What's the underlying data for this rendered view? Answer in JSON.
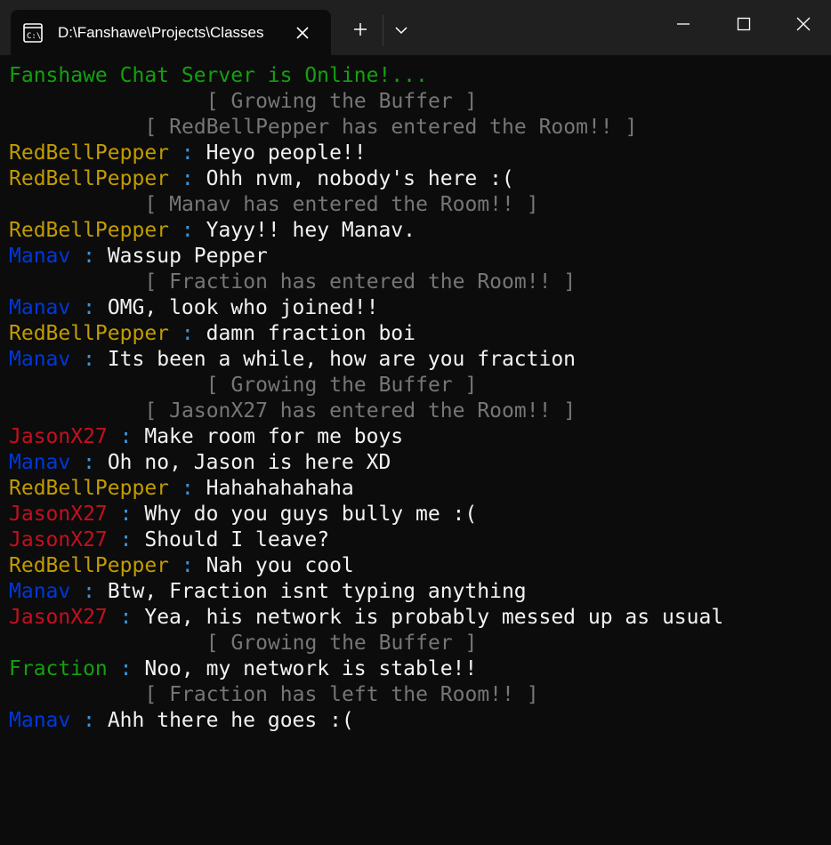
{
  "window": {
    "tab_title": "D:\\Fanshawe\\Projects\\Classes",
    "tab_icon": "terminal-icon",
    "buttons": {
      "new_tab": "plus-icon",
      "dropdown": "chevron-down-icon",
      "minimize": "minimize-icon",
      "maximize": "maximize-icon",
      "close": "close-icon"
    }
  },
  "colors": {
    "background": "#0c0c0c",
    "titlebar": "#202020",
    "online_text": "#13a10e",
    "system_text": "#767676",
    "message_text": "#f2f2f2",
    "separator": "#3a96dd",
    "RedBellPepper": "#c19c00",
    "Manav": "#0037da",
    "JasonX27": "#c50f1f",
    "Fraction": "#13a10e"
  },
  "terminal": {
    "separator": ":",
    "online_message": "Fanshawe Chat Server is Online!...",
    "lines": [
      {
        "type": "system",
        "text": "[ Growing the Buffer ]"
      },
      {
        "type": "system",
        "text": "[ RedBellPepper has entered the Room!! ]"
      },
      {
        "type": "chat",
        "user": "RedBellPepper",
        "text": "Heyo people!!"
      },
      {
        "type": "chat",
        "user": "RedBellPepper",
        "text": "Ohh nvm, nobody's here :("
      },
      {
        "type": "system",
        "text": "[ Manav has entered the Room!! ]"
      },
      {
        "type": "chat",
        "user": "RedBellPepper",
        "text": "Yayy!! hey Manav."
      },
      {
        "type": "chat",
        "user": "Manav",
        "text": "Wassup Pepper"
      },
      {
        "type": "system",
        "text": "[ Fraction has entered the Room!! ]"
      },
      {
        "type": "chat",
        "user": "Manav",
        "text": "OMG, look who joined!!"
      },
      {
        "type": "chat",
        "user": "RedBellPepper",
        "text": "damn fraction boi"
      },
      {
        "type": "chat",
        "user": "Manav",
        "text": "Its been a while, how are you fraction"
      },
      {
        "type": "system",
        "text": "[ Growing the Buffer ]"
      },
      {
        "type": "system",
        "text": "[ JasonX27 has entered the Room!! ]"
      },
      {
        "type": "chat",
        "user": "JasonX27",
        "text": "Make room for me boys"
      },
      {
        "type": "chat",
        "user": "Manav",
        "text": "Oh no, Jason is here XD"
      },
      {
        "type": "chat",
        "user": "RedBellPepper",
        "text": "Hahahahahaha"
      },
      {
        "type": "chat",
        "user": "JasonX27",
        "text": "Why do you guys bully me :("
      },
      {
        "type": "chat",
        "user": "JasonX27",
        "text": "Should I leave?"
      },
      {
        "type": "chat",
        "user": "RedBellPepper",
        "text": "Nah you cool"
      },
      {
        "type": "chat",
        "user": "Manav",
        "text": "Btw, Fraction isnt typing anything"
      },
      {
        "type": "chat",
        "user": "JasonX27",
        "text": "Yea, his network is probably messed up as usual"
      },
      {
        "type": "system",
        "text": "[ Growing the Buffer ]"
      },
      {
        "type": "chat",
        "user": "Fraction",
        "text": "Noo, my network is stable!!"
      },
      {
        "type": "system",
        "text": "[ Fraction has left the Room!! ]"
      },
      {
        "type": "chat",
        "user": "Manav",
        "text": "Ahh there he goes :("
      }
    ]
  }
}
